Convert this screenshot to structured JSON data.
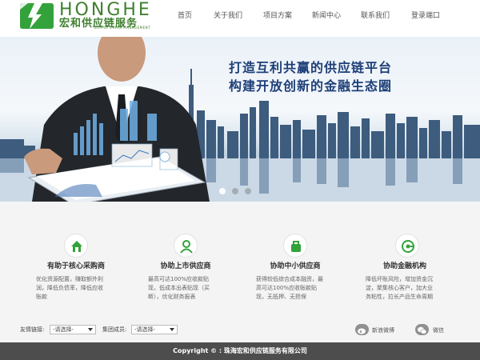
{
  "brand": {
    "name_en": "HONGHE",
    "name_cn": "宏和供应链服务",
    "subtitle": "SUPPLY CHAIN MANAGEMENT",
    "accent": "#33a23a"
  },
  "nav": {
    "items": [
      "首页",
      "关于我们",
      "项目方案",
      "新闻中心",
      "联系我们",
      "登录端口"
    ]
  },
  "banner": {
    "headline1": "打造互利共赢的供应链平台",
    "headline2": "构建开放创新的金融生态圈",
    "slides_count": 3,
    "active_slide": 1
  },
  "features": [
    {
      "icon": "house-icon",
      "title": "有助于核心采购商",
      "lines": [
        "优化资源配置，赚取额外利",
        "润，降低负债率，降低应收",
        "账款"
      ]
    },
    {
      "icon": "user-icon",
      "title": "协助上市供应商",
      "lines": [
        "最高可达100%应收款贴",
        "现，低成本出表贴现（买",
        "断），优化财务报表"
      ]
    },
    {
      "icon": "bag-icon",
      "title": "协助中小供应商",
      "lines": [
        "获得较低综合成本融资，最",
        "高可达100%应收账款贴",
        "现，无抵押、无担保"
      ]
    },
    {
      "icon": "at-icon",
      "title": "协助金融机构",
      "lines": [
        "降低坏账风险，增加资金沉",
        "淀，聚集核心客户，加大业",
        "务粘性，拉长产品生命周期"
      ]
    }
  ],
  "links": {
    "friends_label": "友情链接:",
    "friends_select": "-请选择-",
    "group_label": "集团成员:",
    "group_select": "-请选择-",
    "weibo_label": "新浪微博",
    "wechat_label": "微信"
  },
  "footer": {
    "copyright": "Copyright © : 珠海宏和供应链服务有限公司"
  }
}
